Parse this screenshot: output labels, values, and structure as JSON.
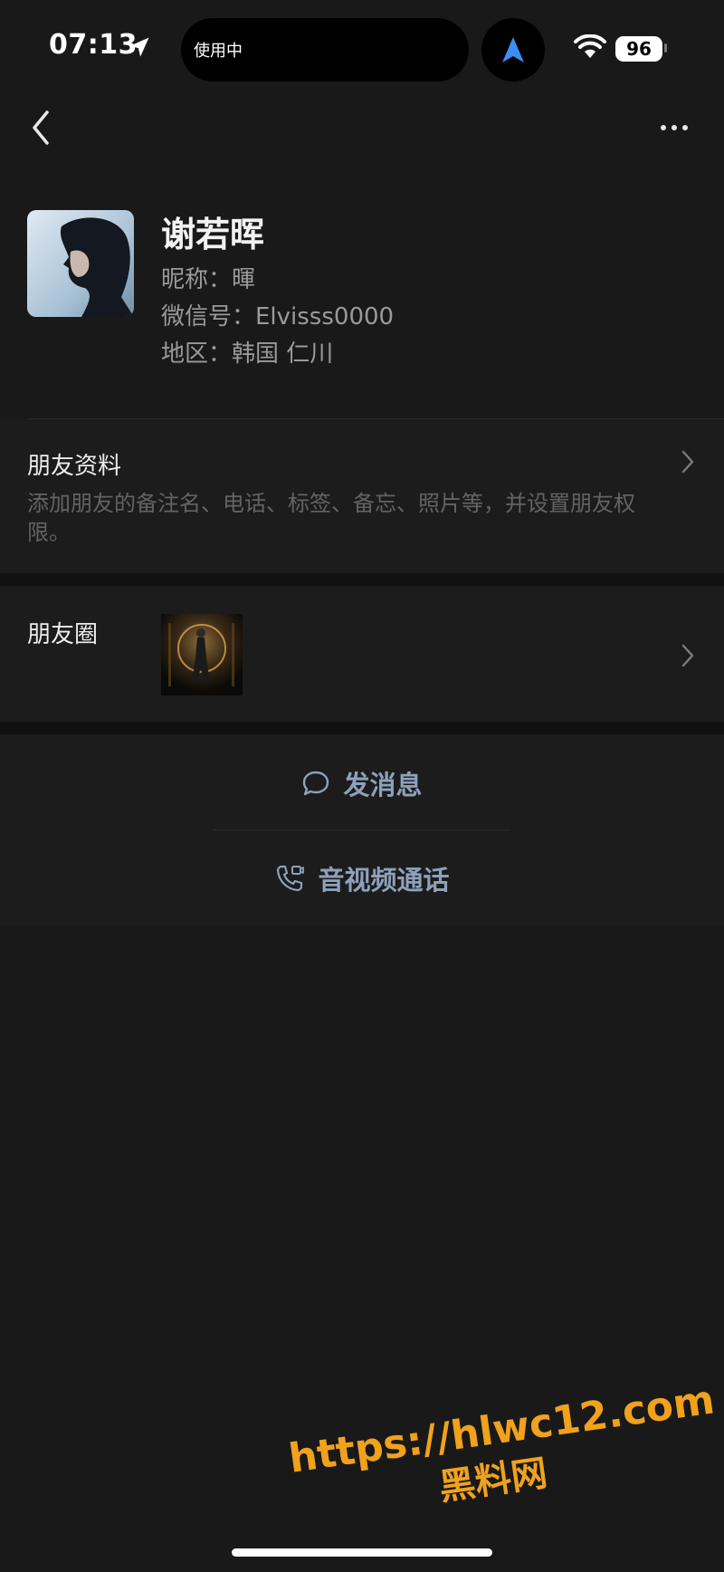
{
  "status_bar": {
    "time": "07:13",
    "island_text": "使用中",
    "battery": "96"
  },
  "icons": {
    "back": "chevron-left-icon",
    "more": "more-icon",
    "chevron": "chevron-right-icon",
    "message": "chat-bubble-icon",
    "call": "video-call-icon"
  },
  "profile": {
    "name": "谢若晖",
    "nickname_line": "昵称：暉",
    "wechat_id_line": "微信号：Elvisss0000",
    "region_line": "地区：韩国 仁川"
  },
  "friend_info": {
    "title": "朋友资料",
    "description": "添加朋友的备注名、电话、标签、备忘、照片等，并设置朋友权限。"
  },
  "moments": {
    "title": "朋友圈"
  },
  "actions": {
    "message_label": "发消息",
    "call_label": "音视频通话"
  },
  "watermark": {
    "url": "https://hlwc12.com",
    "name": "黑料网"
  },
  "colors": {
    "background": "#191919",
    "action_text": "#8ea0ba",
    "watermark": "#f0a21c"
  }
}
